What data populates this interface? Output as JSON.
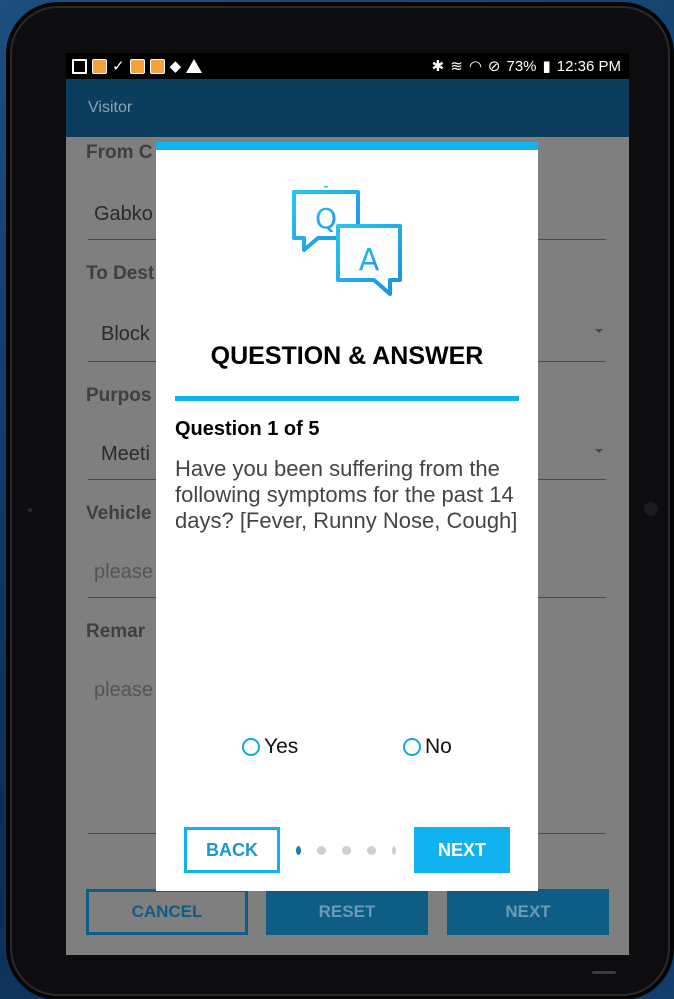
{
  "status_bar": {
    "icons_left": [
      "image-icon",
      "app-icon",
      "check-icon",
      "app-icon",
      "app-icon",
      "nav-icon",
      "warning-icon"
    ],
    "battery": "73%",
    "time": "12:36 PM"
  },
  "app_bar": {
    "title": "Visitor"
  },
  "form": {
    "from_label": "From C",
    "from_value": "Gabko",
    "to_label": "To Dest",
    "to_value": "Block",
    "purpose_label": "Purpos",
    "purpose_value": "Meeti",
    "vehicle_label": "Vehicle",
    "vehicle_placeholder": "please",
    "remarks_label": "Remar",
    "remarks_placeholder": "please"
  },
  "bottom_buttons": {
    "cancel": "CANCEL",
    "reset": "RESET",
    "next": "NEXT"
  },
  "dialog": {
    "title": "QUESTION & ANSWER",
    "question_counter": "Question 1 of 5",
    "question_text": "Have you been suffering from the following symptoms for the past 14 days? [Fever, Runny Nose, Cough]",
    "option_yes": "Yes",
    "option_no": "No",
    "back_label": "BACK",
    "next_label": "NEXT",
    "page_count": 5,
    "current_page": 1
  },
  "colors": {
    "accent": "#12b2ee",
    "appbar": "#0c3d5c",
    "button_dark": "#0e5d84"
  }
}
